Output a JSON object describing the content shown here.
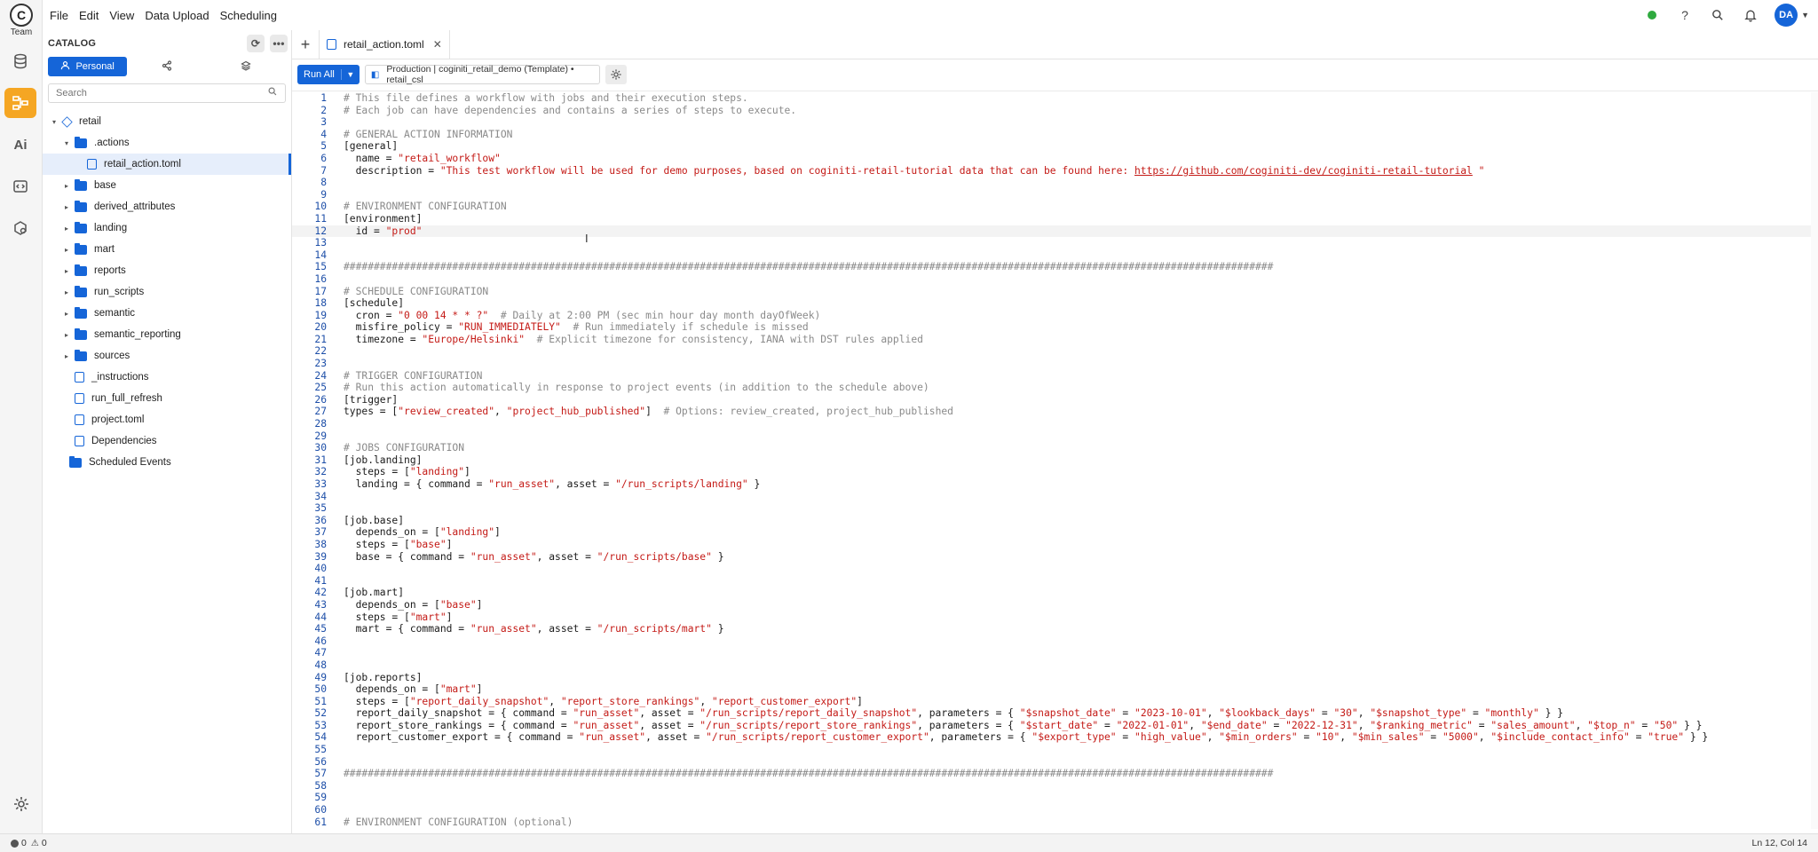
{
  "app": {
    "logo_letter": "C",
    "team_label": "Team"
  },
  "menu": [
    "File",
    "Edit",
    "View",
    "Data Upload",
    "Scheduling"
  ],
  "user": {
    "initials": "DA",
    "status_color": "#2faa3f"
  },
  "rail": {
    "active": "workflows-icon",
    "ai_label": "Ai"
  },
  "catalog": {
    "title": "CATALOG",
    "tabs": [
      {
        "label": "Personal",
        "icon": "person-icon"
      },
      {
        "label": "",
        "icon": "share-icon"
      },
      {
        "label": "",
        "icon": "layers-icon"
      }
    ],
    "search_placeholder": "Search",
    "tree": [
      {
        "label": "retail",
        "level": 0,
        "type": "project",
        "caret": "▾"
      },
      {
        "label": ".actions",
        "level": 1,
        "type": "folder",
        "caret": "▾"
      },
      {
        "label": "retail_action.toml",
        "level": 2,
        "type": "file",
        "caret": ""
      },
      {
        "label": "base",
        "level": 1,
        "type": "folder",
        "caret": "▸"
      },
      {
        "label": "derived_attributes",
        "level": 1,
        "type": "folder",
        "caret": "▸"
      },
      {
        "label": "landing",
        "level": 1,
        "type": "folder",
        "caret": "▸"
      },
      {
        "label": "mart",
        "level": 1,
        "type": "folder",
        "caret": "▸"
      },
      {
        "label": "reports",
        "level": 1,
        "type": "folder",
        "caret": "▸"
      },
      {
        "label": "run_scripts",
        "level": 1,
        "type": "folder",
        "caret": "▸"
      },
      {
        "label": "semantic",
        "level": 1,
        "type": "folder",
        "caret": "▸"
      },
      {
        "label": "semantic_reporting",
        "level": 1,
        "type": "folder",
        "caret": "▸"
      },
      {
        "label": "sources",
        "level": 1,
        "type": "folder",
        "caret": "▸"
      },
      {
        "label": "_instructions",
        "level": 1,
        "type": "file",
        "caret": ""
      },
      {
        "label": "run_full_refresh",
        "level": 1,
        "type": "file",
        "caret": ""
      },
      {
        "label": "project.toml",
        "level": 1,
        "type": "file",
        "caret": ""
      },
      {
        "label": "Dependencies",
        "level": 1,
        "type": "file",
        "caret": ""
      },
      {
        "label": "Scheduled Events",
        "level": 0,
        "type": "folder",
        "caret": ""
      }
    ]
  },
  "editor": {
    "tab_title": "retail_action.toml",
    "run_all_label": "Run All",
    "connection": "Production | coginiti_retail_demo (Template) • retail_csl",
    "cursor_line": 12,
    "lines": [
      [
        [
          "c",
          "# This file defines a workflow with jobs and their execution steps."
        ]
      ],
      [
        [
          "c",
          "# Each job can have dependencies and contains a series of steps to execute."
        ]
      ],
      [],
      [
        [
          "c",
          "# GENERAL ACTION INFORMATION"
        ]
      ],
      [
        [
          "t",
          "[general]"
        ]
      ],
      [
        [
          "t",
          "  name = "
        ],
        [
          "s",
          "\"retail_workflow\""
        ]
      ],
      [
        [
          "t",
          "  description = "
        ],
        [
          "s",
          "\"This test workflow will be used for demo purposes, based on coginiti-retail-tutorial data that can be found here: "
        ],
        [
          "l",
          "https://github.com/coginiti-dev/coginiti-retail-tutorial"
        ],
        [
          "s",
          " \""
        ]
      ],
      [],
      [],
      [
        [
          "c",
          "# ENVIRONMENT CONFIGURATION"
        ]
      ],
      [
        [
          "t",
          "[environment]"
        ]
      ],
      [
        [
          "t",
          "  id = "
        ],
        [
          "s",
          "\"prod\""
        ]
      ],
      [],
      [],
      [
        [
          "c",
          "##########################################################################################################################################################"
        ]
      ],
      [],
      [
        [
          "c",
          "# SCHEDULE CONFIGURATION"
        ]
      ],
      [
        [
          "t",
          "[schedule]"
        ]
      ],
      [
        [
          "t",
          "  cron = "
        ],
        [
          "s",
          "\"0 00 14 * * ?\""
        ],
        [
          "c",
          "  # Daily at 2:00 PM (sec min hour day month dayOfWeek)"
        ]
      ],
      [
        [
          "t",
          "  misfire_policy = "
        ],
        [
          "s",
          "\"RUN_IMMEDIATELY\""
        ],
        [
          "c",
          "  # Run immediately if schedule is missed"
        ]
      ],
      [
        [
          "t",
          "  timezone = "
        ],
        [
          "s",
          "\"Europe/Helsinki\""
        ],
        [
          "c",
          "  # Explicit timezone for consistency, IANA with DST rules applied"
        ]
      ],
      [],
      [],
      [
        [
          "c",
          "# TRIGGER CONFIGURATION"
        ]
      ],
      [
        [
          "c",
          "# Run this action automatically in response to project events (in addition to the schedule above)"
        ]
      ],
      [
        [
          "t",
          "[trigger]"
        ]
      ],
      [
        [
          "t",
          "types = ["
        ],
        [
          "s",
          "\"review_created\""
        ],
        [
          "t",
          ", "
        ],
        [
          "s",
          "\"project_hub_published\""
        ],
        [
          "t",
          "]"
        ],
        [
          "c",
          "  # Options: review_created, project_hub_published"
        ]
      ],
      [],
      [],
      [
        [
          "c",
          "# JOBS CONFIGURATION"
        ]
      ],
      [
        [
          "t",
          "[job.landing]"
        ]
      ],
      [
        [
          "t",
          "  steps = ["
        ],
        [
          "s",
          "\"landing\""
        ],
        [
          "t",
          "]"
        ]
      ],
      [
        [
          "t",
          "  landing = { command = "
        ],
        [
          "s",
          "\"run_asset\""
        ],
        [
          "t",
          ", asset = "
        ],
        [
          "s",
          "\"/run_scripts/landing\""
        ],
        [
          "t",
          " }"
        ]
      ],
      [],
      [],
      [
        [
          "t",
          "[job.base]"
        ]
      ],
      [
        [
          "t",
          "  depends_on = ["
        ],
        [
          "s",
          "\"landing\""
        ],
        [
          "t",
          "]"
        ]
      ],
      [
        [
          "t",
          "  steps = ["
        ],
        [
          "s",
          "\"base\""
        ],
        [
          "t",
          "]"
        ]
      ],
      [
        [
          "t",
          "  base = { command = "
        ],
        [
          "s",
          "\"run_asset\""
        ],
        [
          "t",
          ", asset = "
        ],
        [
          "s",
          "\"/run_scripts/base\""
        ],
        [
          "t",
          " }"
        ]
      ],
      [],
      [],
      [
        [
          "t",
          "[job.mart]"
        ]
      ],
      [
        [
          "t",
          "  depends_on = ["
        ],
        [
          "s",
          "\"base\""
        ],
        [
          "t",
          "]"
        ]
      ],
      [
        [
          "t",
          "  steps = ["
        ],
        [
          "s",
          "\"mart\""
        ],
        [
          "t",
          "]"
        ]
      ],
      [
        [
          "t",
          "  mart = { command = "
        ],
        [
          "s",
          "\"run_asset\""
        ],
        [
          "t",
          ", asset = "
        ],
        [
          "s",
          "\"/run_scripts/mart\""
        ],
        [
          "t",
          " }"
        ]
      ],
      [],
      [],
      [],
      [
        [
          "t",
          "[job.reports]"
        ]
      ],
      [
        [
          "t",
          "  depends_on = ["
        ],
        [
          "s",
          "\"mart\""
        ],
        [
          "t",
          "]"
        ]
      ],
      [
        [
          "t",
          "  steps = ["
        ],
        [
          "s",
          "\"report_daily_snapshot\""
        ],
        [
          "t",
          ", "
        ],
        [
          "s",
          "\"report_store_rankings\""
        ],
        [
          "t",
          ", "
        ],
        [
          "s",
          "\"report_customer_export\""
        ],
        [
          "t",
          "]"
        ]
      ],
      [
        [
          "t",
          "  report_daily_snapshot = { command = "
        ],
        [
          "s",
          "\"run_asset\""
        ],
        [
          "t",
          ", asset = "
        ],
        [
          "s",
          "\"/run_scripts/report_daily_snapshot\""
        ],
        [
          "t",
          ", parameters = { "
        ],
        [
          "s",
          "\"$snapshot_date\""
        ],
        [
          "t",
          " = "
        ],
        [
          "s",
          "\"2023-10-01\""
        ],
        [
          "t",
          ", "
        ],
        [
          "s",
          "\"$lookback_days\""
        ],
        [
          "t",
          " = "
        ],
        [
          "s",
          "\"30\""
        ],
        [
          "t",
          ", "
        ],
        [
          "s",
          "\"$snapshot_type\""
        ],
        [
          "t",
          " = "
        ],
        [
          "s",
          "\"monthly\""
        ],
        [
          "t",
          " } }"
        ]
      ],
      [
        [
          "t",
          "  report_store_rankings = { command = "
        ],
        [
          "s",
          "\"run_asset\""
        ],
        [
          "t",
          ", asset = "
        ],
        [
          "s",
          "\"/run_scripts/report_store_rankings\""
        ],
        [
          "t",
          ", parameters = { "
        ],
        [
          "s",
          "\"$start_date\""
        ],
        [
          "t",
          " = "
        ],
        [
          "s",
          "\"2022-01-01\""
        ],
        [
          "t",
          ", "
        ],
        [
          "s",
          "\"$end_date\""
        ],
        [
          "t",
          " = "
        ],
        [
          "s",
          "\"2022-12-31\""
        ],
        [
          "t",
          ", "
        ],
        [
          "s",
          "\"$ranking_metric\""
        ],
        [
          "t",
          " = "
        ],
        [
          "s",
          "\"sales_amount\""
        ],
        [
          "t",
          ", "
        ],
        [
          "s",
          "\"$top_n\""
        ],
        [
          "t",
          " = "
        ],
        [
          "s",
          "\"50\""
        ],
        [
          "t",
          " } }"
        ]
      ],
      [
        [
          "t",
          "  report_customer_export = { command = "
        ],
        [
          "s",
          "\"run_asset\""
        ],
        [
          "t",
          ", asset = "
        ],
        [
          "s",
          "\"/run_scripts/report_customer_export\""
        ],
        [
          "t",
          ", parameters = { "
        ],
        [
          "s",
          "\"$export_type\""
        ],
        [
          "t",
          " = "
        ],
        [
          "s",
          "\"high_value\""
        ],
        [
          "t",
          ", "
        ],
        [
          "s",
          "\"$min_orders\""
        ],
        [
          "t",
          " = "
        ],
        [
          "s",
          "\"10\""
        ],
        [
          "t",
          ", "
        ],
        [
          "s",
          "\"$min_sales\""
        ],
        [
          "t",
          " = "
        ],
        [
          "s",
          "\"5000\""
        ],
        [
          "t",
          ", "
        ],
        [
          "s",
          "\"$include_contact_info\""
        ],
        [
          "t",
          " = "
        ],
        [
          "s",
          "\"true\""
        ],
        [
          "t",
          " } }"
        ]
      ],
      [],
      [],
      [
        [
          "c",
          "##########################################################################################################################################################"
        ]
      ],
      [],
      [],
      [],
      [
        [
          "c",
          "# ENVIRONMENT CONFIGURATION (optional)"
        ]
      ]
    ]
  },
  "status": {
    "errors": "0",
    "warnings": "0",
    "cursor_pos": "Ln 12, Col 14"
  }
}
